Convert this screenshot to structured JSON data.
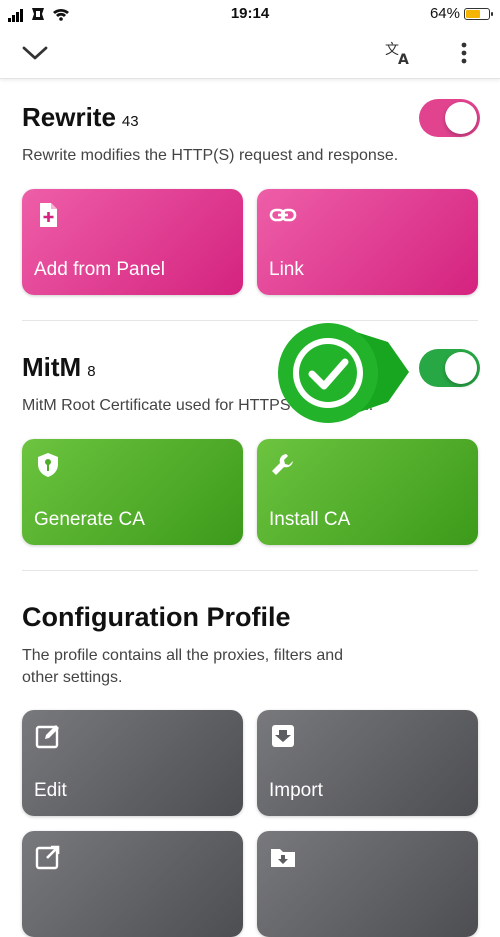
{
  "status_bar": {
    "time": "19:14",
    "battery": "64%"
  },
  "rewrite": {
    "title": "Rewrite",
    "count": "43",
    "description": "Rewrite modifies the HTTP(S) request and response.",
    "toggle_on": true,
    "color": "#e1438f",
    "actions": [
      {
        "label": "Add from Panel",
        "icon": "add-file-icon"
      },
      {
        "label": "Link",
        "icon": "link-icon"
      }
    ]
  },
  "mitm": {
    "title": "MitM",
    "count": "8",
    "description": "MitM Root Certificate used for HTTPS decryption.",
    "toggle_on": true,
    "color": "#28a745",
    "actions": [
      {
        "label": "Generate CA",
        "icon": "shield-key-icon"
      },
      {
        "label": "Install CA",
        "icon": "wrench-icon"
      }
    ]
  },
  "config": {
    "title": "Configuration Profile",
    "description_line1": "The profile contains all the proxies, filters and",
    "description_line2": "other settings.",
    "actions": [
      {
        "label": "Edit",
        "icon": "edit-icon"
      },
      {
        "label": "Import",
        "icon": "import-icon"
      },
      {
        "label": "",
        "icon": "export-icon"
      },
      {
        "label": "",
        "icon": "folder-download-icon"
      }
    ]
  },
  "overlay": {
    "badge": "checkmark-marker-icon",
    "color": "#22b32a"
  }
}
